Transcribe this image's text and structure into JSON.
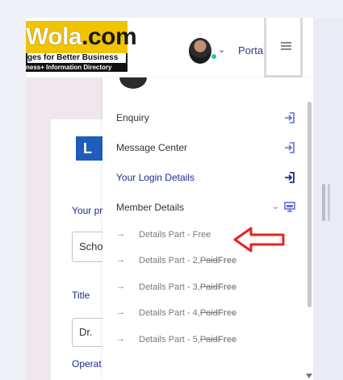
{
  "header": {
    "logo": {
      "main_a": "Wola",
      "main_b": ".com",
      "tagline": "ges for Better Business",
      "subline": "ness+ Information Directory"
    },
    "portal_label": "Porta"
  },
  "form": {
    "logo_text": "L",
    "field1_label": "Your pr",
    "field1_value": "Scho",
    "field2_label": "Title",
    "field2_value": "Dr.",
    "field3_label": "Operat"
  },
  "menu": {
    "items": [
      {
        "label": "Enquiry",
        "icon": "login-icon"
      },
      {
        "label": "Message Center",
        "icon": "login-icon"
      },
      {
        "label": "Your Login Details",
        "icon": "login-icon",
        "active": true
      },
      {
        "label": "Member Details",
        "icon": "monitor-icon",
        "expanded": true
      }
    ],
    "sub_items": [
      {
        "text": "Details Part - Free",
        "paid": "",
        "free": ""
      },
      {
        "text": "Details Part - 2,",
        "paid": "Paid",
        "free": "Free"
      },
      {
        "text": "Details Part - 3,",
        "paid": "Paid",
        "free": "Free"
      },
      {
        "text": "Details Part - 4,",
        "paid": "Paid",
        "free": "Free"
      },
      {
        "text": "Details Part - 5,",
        "paid": "Paid",
        "free": "Free"
      }
    ]
  },
  "colors": {
    "accent": "#2a3b8f",
    "icon_blue": "#5f6fd6",
    "arrow_red": "#e8231d",
    "status_online": "#1ec9a6"
  }
}
